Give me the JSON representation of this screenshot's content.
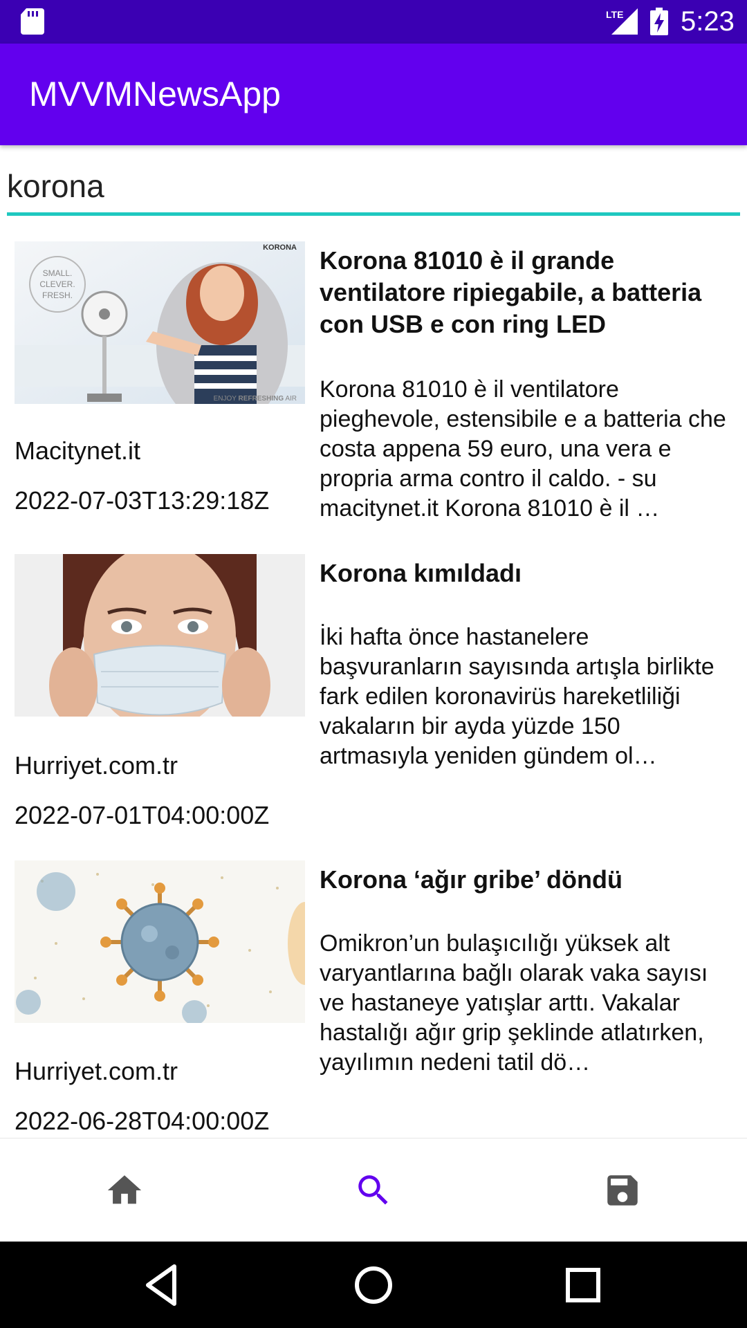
{
  "status_bar": {
    "time": "5:23",
    "network": "LTE"
  },
  "app_bar": {
    "title": "MVVMNewsApp"
  },
  "search": {
    "value": "korona",
    "accent_color": "#1fc8c0"
  },
  "articles": [
    {
      "source": "Macitynet.it",
      "published_at": "2022-07-03T13:29:18Z",
      "title": "Korona 81010 è il grande ventilatore ripiegabile, a batteria con USB e con ring LED",
      "description": "Korona 81010 è il ventilatore pieghevole, estensibile e a batteria che costa appena 59 euro, una vera e propria arma contro il caldo. - su macitynet.it Korona 81010 è il …",
      "image": {
        "brand": "KORONA",
        "badge_line1": "SMALL.",
        "badge_line2": "CLEVER.",
        "badge_line3": "FRESH.",
        "tagline_prefix": "ENJOY ",
        "tagline_bold": "REFRESHING",
        "tagline_suffix": " AIR"
      }
    },
    {
      "source": "Hurriyet.com.tr",
      "published_at": "2022-07-01T04:00:00Z",
      "title": "Korona kımıldadı",
      "description": "İki hafta önce hastanelere başvuranların sayısında artışla birlikte fark edilen koronavirüs hareketliliği vakaların bir ayda yüzde 150 artmasıyla yeniden gündem ol…"
    },
    {
      "source": "Hurriyet.com.tr",
      "published_at": "2022-06-28T04:00:00Z",
      "title": "Korona ‘ağır gribe’ döndü",
      "description": "Omikron’un bulaşıcılığı yüksek alt varyantlarına bağlı olarak vaka sayısı ve hastaneye yatışlar arttı. Vakalar hastalığı ağır grip şeklinde atlatırken, yayılımın nedeni tatil dö…"
    }
  ],
  "bottom_nav": {
    "items": [
      {
        "icon": "home-icon",
        "active": false
      },
      {
        "icon": "search-icon",
        "active": true
      },
      {
        "icon": "save-icon",
        "active": false
      }
    ],
    "active_color": "#6200ee",
    "inactive_color": "#555555"
  },
  "colors": {
    "status_bar": "#3b00b3",
    "app_bar": "#6200ee"
  }
}
